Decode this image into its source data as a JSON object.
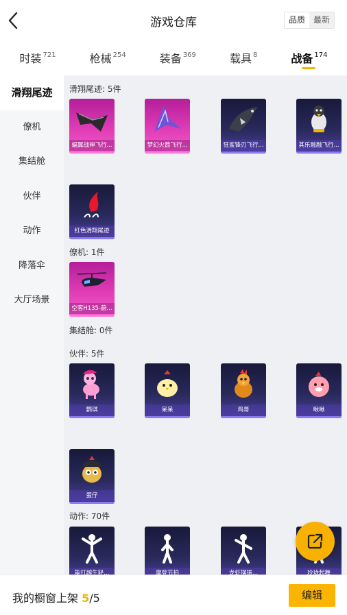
{
  "header": {
    "title": "游戏仓库",
    "sort": [
      "品质",
      "最新"
    ]
  },
  "tabs": [
    {
      "label": "时装",
      "count": "721"
    },
    {
      "label": "枪械",
      "count": "254"
    },
    {
      "label": "装备",
      "count": "369"
    },
    {
      "label": "载具",
      "count": "8"
    },
    {
      "label": "战备",
      "count": "174"
    }
  ],
  "sidebar": [
    "滑翔尾迹",
    "僚机",
    "集结舱",
    "伙伴",
    "动作",
    "降落伞",
    "大厅场景"
  ],
  "sections": {
    "trail": {
      "title": "滑翔尾迹: 5件",
      "items": [
        "蝠翼战神飞行...",
        "梦幻火箭飞行...",
        "狂鲨锋刃飞行...",
        "其乐融融飞行...",
        "红色滑翔尾迹"
      ]
    },
    "wingman": {
      "title": "僚机: 1件",
      "items": [
        "空客H135-蔚..."
      ]
    },
    "capsule": {
      "title": "集结舱: 0件"
    },
    "partner": {
      "title": "伙伴: 5件",
      "items": [
        "鹦琪",
        "呆呆",
        "鸡哥",
        "啾啾",
        "蛋仔"
      ]
    },
    "emote": {
      "title": "动作: 70件",
      "items": [
        "能打越生轻...",
        "摩登节拍",
        "龙虾摆振...",
        "玲珑起舞"
      ]
    }
  },
  "bottom": {
    "label": "我的橱窗上架",
    "current": "5",
    "total": "/5",
    "edit": "编辑"
  },
  "colors": {
    "accent": "#fbb500",
    "purple_card": "#28295a",
    "pink_card": "#e33fb8"
  },
  "icons": {
    "back": "chevron-left-icon",
    "share": "share-external-icon"
  }
}
